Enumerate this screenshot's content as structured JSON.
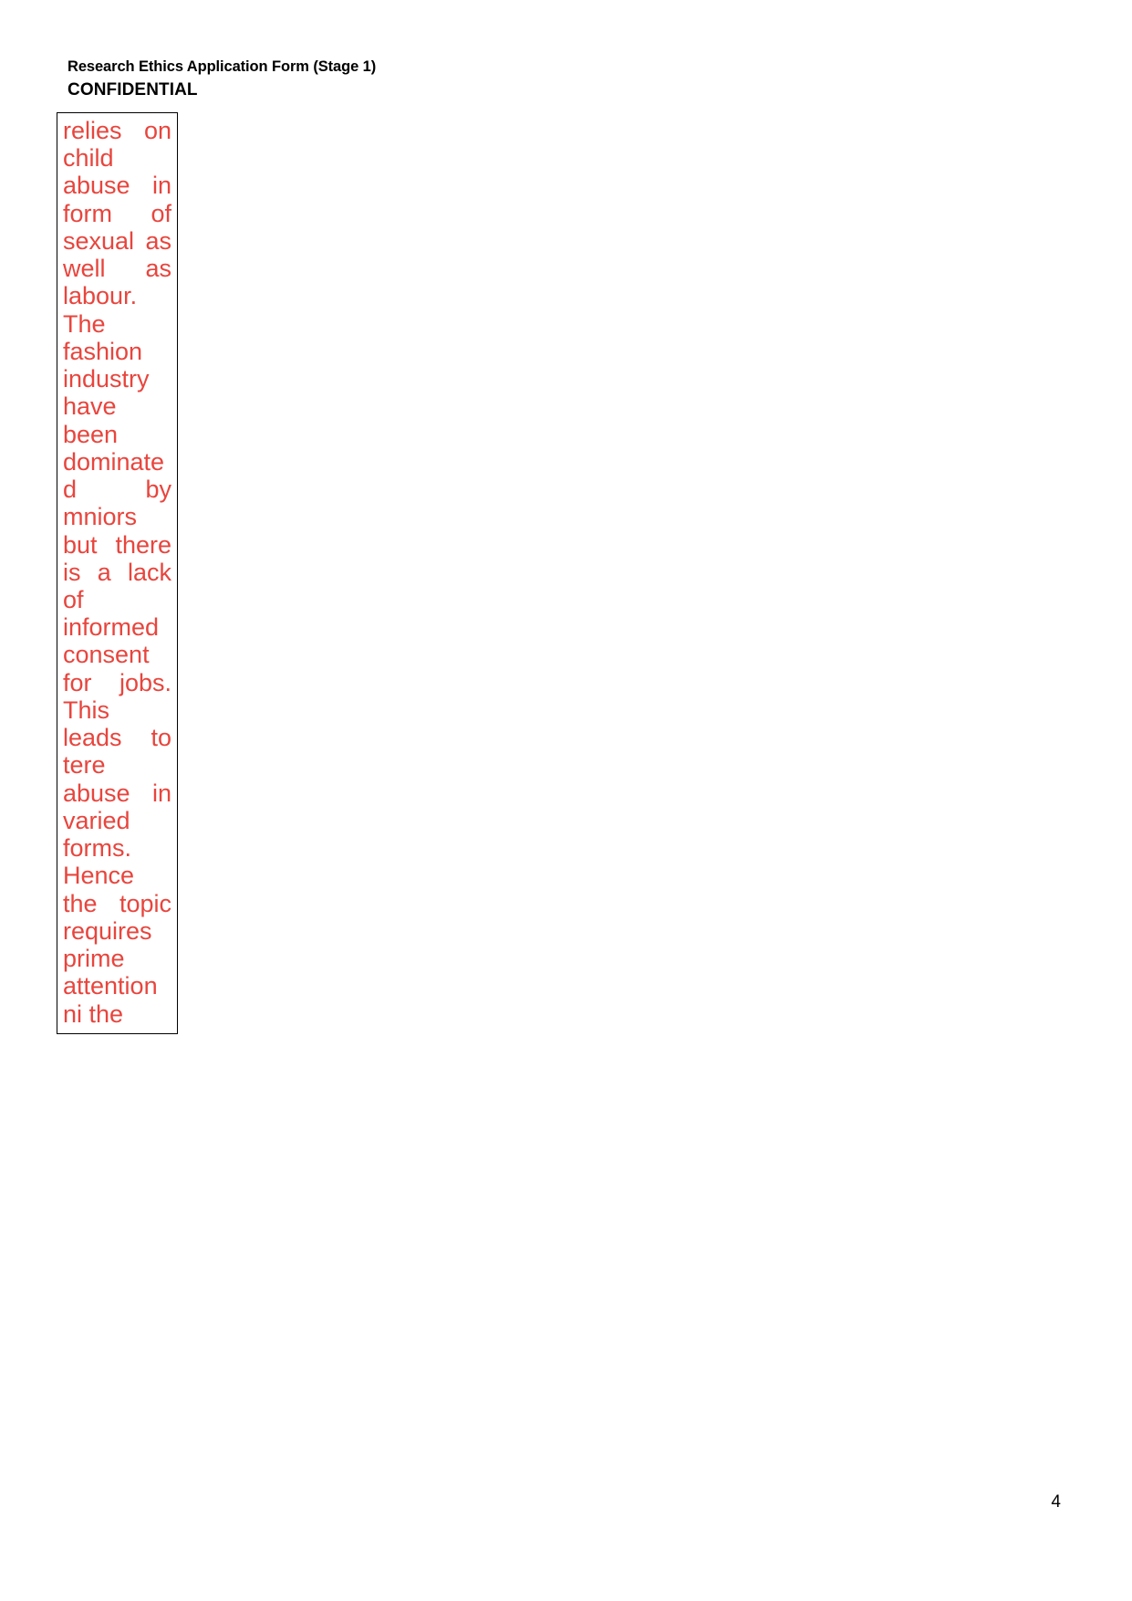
{
  "document": {
    "header": {
      "title": "Research Ethics Application Form (Stage 1)",
      "confidential_label": "CONFIDENTIAL"
    },
    "answer_box": {
      "text_color": "#E8453D",
      "border_color": "#000000",
      "content": "relies on child abuse in form of sexual as well as labour. The fashion industry have been dominated by mniors but there is a lack of informed consent for jobs. This leads to tere abuse in varied forms. Hence the topic requires prime attention ni the"
    },
    "footer": {
      "page_number": "4"
    }
  }
}
